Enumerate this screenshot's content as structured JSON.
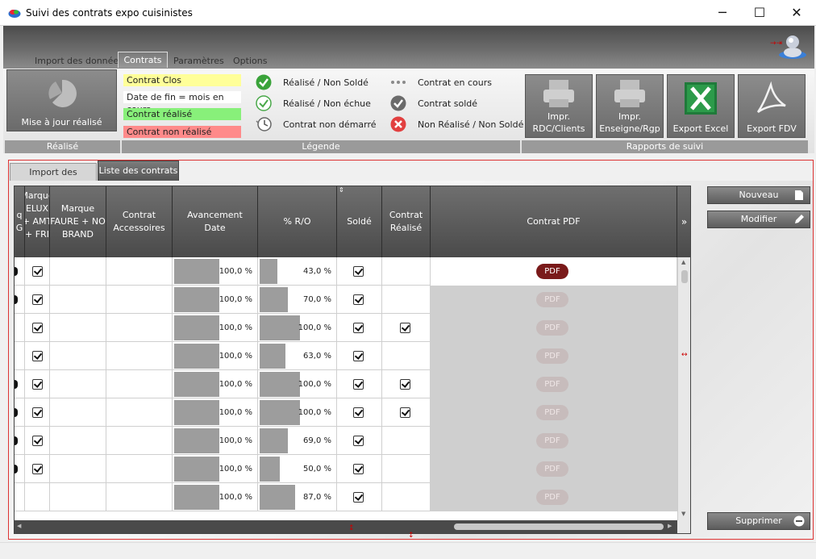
{
  "window": {
    "title": "Suivi des contrats expo cuisinistes",
    "minimize": "─",
    "maximize": "☐",
    "close": "✕"
  },
  "ribbon": {
    "tabs": [
      "Import des données",
      "Contrats",
      "Paramètres",
      "Options"
    ],
    "groups": {
      "realise": "Réalisé",
      "legende": "Légende",
      "rapports": "Rapports de suivi"
    },
    "update_button": "Mise à jour réalisé",
    "legend_boxes": [
      {
        "label": "Contrat Clos",
        "color": "#ffff99"
      },
      {
        "label": "Date de fin = mois en cours",
        "color": "#ffffff"
      },
      {
        "label": "Contrat réalisé",
        "color": "#88f07a"
      },
      {
        "label": "Contrat non réalisé",
        "color": "#ff8a8a"
      }
    ],
    "legend_icons": [
      {
        "label": "Réalisé / Non Soldé",
        "icon": "check-filled-green-icon"
      },
      {
        "label": "Réalisé / Non échue",
        "icon": "check-outline-green-icon"
      },
      {
        "label": "Contrat non démarré",
        "icon": "clock-icon"
      },
      {
        "label": "Contrat en cours",
        "icon": "dots-icon"
      },
      {
        "label": "Contrat soldé",
        "icon": "check-grey-icon"
      },
      {
        "label": "Non Réalisé / Non Soldé",
        "icon": "cross-red-icon"
      }
    ],
    "report_buttons": [
      {
        "line1": "Impr.",
        "line2": "RDC/Clients"
      },
      {
        "line1": "Impr.",
        "line2": "Enseigne/Rgp"
      },
      {
        "line1": "",
        "line2": "Export Excel"
      },
      {
        "line1": "",
        "line2": "Export FDV"
      }
    ]
  },
  "subtabs": [
    "Import des données",
    "Liste des contrats"
  ],
  "grid": {
    "headers": {
      "col0": "q\nG",
      "col1": "Marque\nELUX\n+ AMT\n+ FRI",
      "col2": "Marque\nFAURE + NO\nBRAND",
      "col3": "Contrat\nAccessoires",
      "col4": "Avancement\nDate",
      "col5": "% R/O",
      "col6": "Soldé",
      "col7": "Contrat\nRéalisé",
      "col8": "Contrat PDF"
    },
    "pdf_label": "PDF",
    "rows": [
      {
        "dot": true,
        "marque": true,
        "avancement": 100.0,
        "avancement_label": "100,0 %",
        "ro": 43.0,
        "ro_label": "43,0 %",
        "solde": true,
        "realise": false,
        "pdf_active": true
      },
      {
        "dot": true,
        "marque": true,
        "avancement": 100.0,
        "avancement_label": "100,0 %",
        "ro": 70.0,
        "ro_label": "70,0 %",
        "solde": true,
        "realise": false,
        "pdf_active": false
      },
      {
        "dot": false,
        "marque": true,
        "avancement": 100.0,
        "avancement_label": "100,0 %",
        "ro": 100.0,
        "ro_label": "100,0 %",
        "solde": true,
        "realise": true,
        "pdf_active": false
      },
      {
        "dot": false,
        "marque": true,
        "avancement": 100.0,
        "avancement_label": "100,0 %",
        "ro": 63.0,
        "ro_label": "63,0 %",
        "solde": true,
        "realise": false,
        "pdf_active": false
      },
      {
        "dot": true,
        "marque": true,
        "avancement": 100.0,
        "avancement_label": "100,0 %",
        "ro": 100.0,
        "ro_label": "100,0 %",
        "solde": true,
        "realise": true,
        "pdf_active": false
      },
      {
        "dot": true,
        "marque": true,
        "avancement": 100.0,
        "avancement_label": "100,0 %",
        "ro": 100.0,
        "ro_label": "100,0 %",
        "solde": true,
        "realise": true,
        "pdf_active": false
      },
      {
        "dot": true,
        "marque": true,
        "avancement": 100.0,
        "avancement_label": "100,0 %",
        "ro": 69.0,
        "ro_label": "69,0 %",
        "solde": true,
        "realise": false,
        "pdf_active": false
      },
      {
        "dot": true,
        "marque": true,
        "avancement": 100.0,
        "avancement_label": "100,0 %",
        "ro": 50.0,
        "ro_label": "50,0 %",
        "solde": true,
        "realise": false,
        "pdf_active": false
      },
      {
        "dot": false,
        "marque": false,
        "avancement": 100.0,
        "avancement_label": "100,0 %",
        "ro": 87.0,
        "ro_label": "87,0 %",
        "solde": true,
        "realise": false,
        "pdf_active": false
      }
    ]
  },
  "side_buttons": {
    "nouveau": "Nouveau",
    "modifier": "Modifier",
    "supprimer": "Supprimer"
  }
}
